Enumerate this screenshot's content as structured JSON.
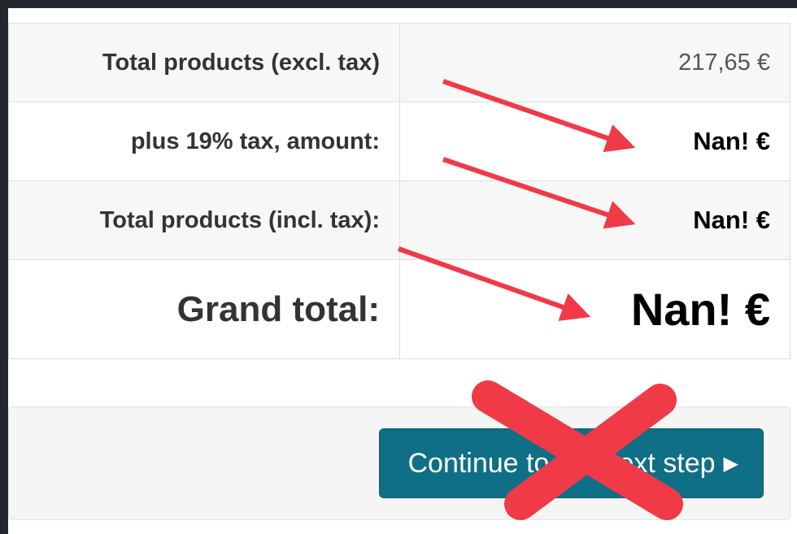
{
  "totals": {
    "rows": [
      {
        "label": "Total products (excl. tax)",
        "value": "217,65 €"
      },
      {
        "label": "plus 19% tax, amount:",
        "value": "Nan! €"
      },
      {
        "label": "Total products (incl. tax):",
        "value": "Nan! €"
      }
    ],
    "grand": {
      "label": "Grand total:",
      "value": "Nan! €"
    }
  },
  "footer": {
    "continue_label": "Continue to the next step",
    "continue_icon": "caret-right-icon"
  },
  "annotations": {
    "arrow_color": "#f03a47",
    "cross_color": "#f03a47"
  }
}
